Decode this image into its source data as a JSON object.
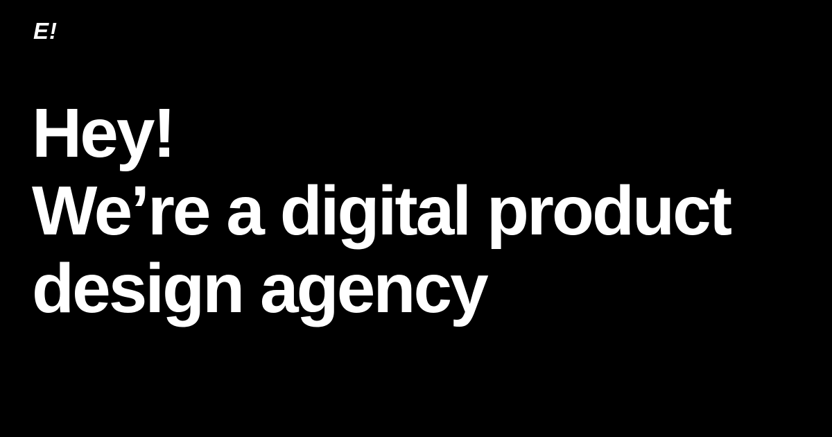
{
  "brand": {
    "logo_text": "E!"
  },
  "hero": {
    "lines": [
      "Hey!",
      "We’re a digital product",
      "design agency"
    ]
  },
  "colors": {
    "background": "#000000",
    "text": "#ffffff"
  }
}
